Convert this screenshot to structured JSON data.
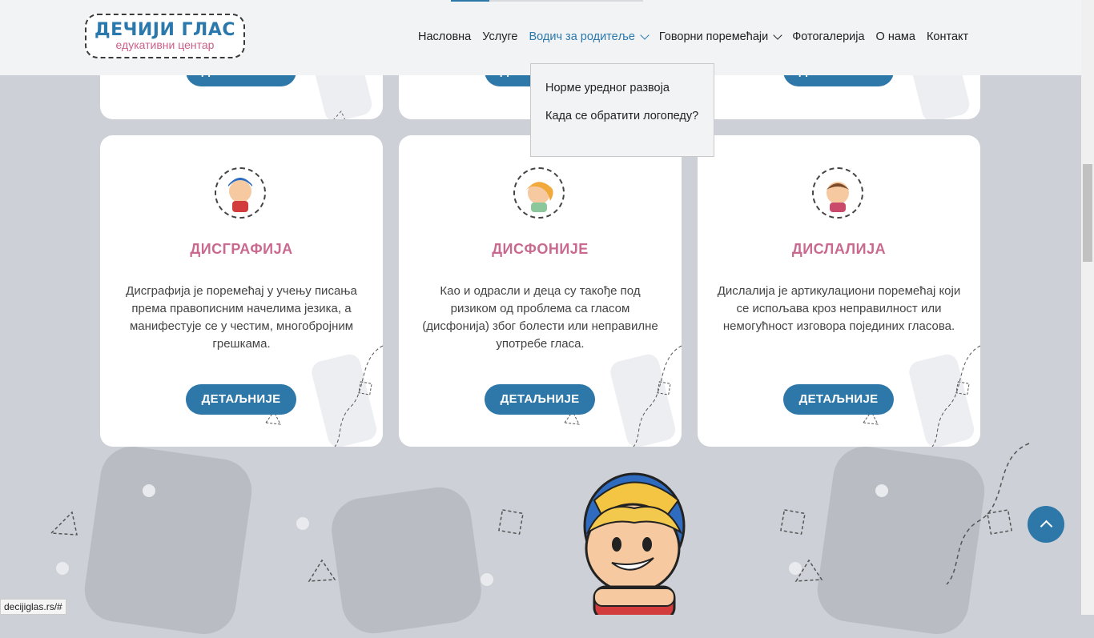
{
  "logo": {
    "main": "ДЕЧИЈИ ГЛАС",
    "sub": "едукативни центар"
  },
  "nav": [
    {
      "label": "Насловна"
    },
    {
      "label": "Услуге"
    },
    {
      "label": "Водич за родитеље"
    },
    {
      "label": "Говорни поремећаји"
    },
    {
      "label": "Фотогалерија"
    },
    {
      "label": "О нама"
    },
    {
      "label": "Контакт"
    }
  ],
  "dropdown": [
    {
      "label": "Норме уредног развоја"
    },
    {
      "label": "Када се обратити логопеду?"
    }
  ],
  "top_cards": [
    {
      "button": "ДЕТАЉНИЈЕ"
    },
    {
      "button": "ДЕТАЉНИЈЕ"
    },
    {
      "button": "ДЕТАЉНИЈЕ"
    }
  ],
  "cards": [
    {
      "title": "ДИСГРАФИЈА",
      "text": "Дисграфија је поремећај у учењу писања према правописним начелима језика, а манифестује се у честим, многобројним грешкама.",
      "button": "ДЕТАЉНИЈЕ"
    },
    {
      "title": "ДИСФОНИЈЕ",
      "text": "Као и одрасли и деца су такође под ризиком од проблема са гласом (дисфонија) због болести или неправилне употребе гласа.",
      "button": "ДЕТАЉНИЈЕ"
    },
    {
      "title": "ДИСЛАЛИЈА",
      "text": "Дислалија је артикулациони поремећај који се испољава кроз неправилност или немогућност изговора појединих гласова.",
      "button": "ДЕТАЉНИЈЕ"
    }
  ],
  "statusbar": "decijiglas.rs/#",
  "colors": {
    "accent": "#2e77a9",
    "title": "#c9698f",
    "background": "#cdd0d6"
  }
}
